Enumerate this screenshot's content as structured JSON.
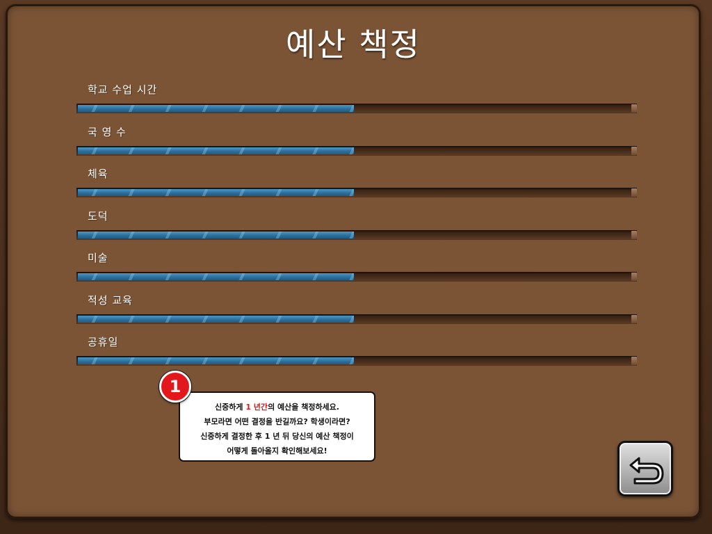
{
  "title": "예산 책정",
  "categories": [
    {
      "label": "학교 수업 시간",
      "level": 0.5
    },
    {
      "label": "국 영 수",
      "level": 0.5
    },
    {
      "label": "체육",
      "level": 0.5
    },
    {
      "label": "도덕",
      "level": 0.5
    },
    {
      "label": "미술",
      "level": 0.5
    },
    {
      "label": "적성 교육",
      "level": 0.5
    },
    {
      "label": "공휴일",
      "level": 0.5
    }
  ],
  "tutorial": {
    "step": "1",
    "line1_before": "신중하게 ",
    "line1_highlight": "1 년간",
    "line1_after": "의 예산을 책정하세요.",
    "line2": "부모라면 어떤 결정을 반길까요? 학생이라면?",
    "line3": "신중하게 결정한 후 1 년 뒤 당신의 예산 책정이",
    "line4": "어떻게 돌아올지 확인해보세요!"
  },
  "icons": {
    "back": "return-arrow-icon"
  },
  "colors": {
    "board": "#7b5436",
    "slider_fill": "#2e6f9c",
    "highlight": "#e3141a",
    "badge": "#e2181d"
  }
}
